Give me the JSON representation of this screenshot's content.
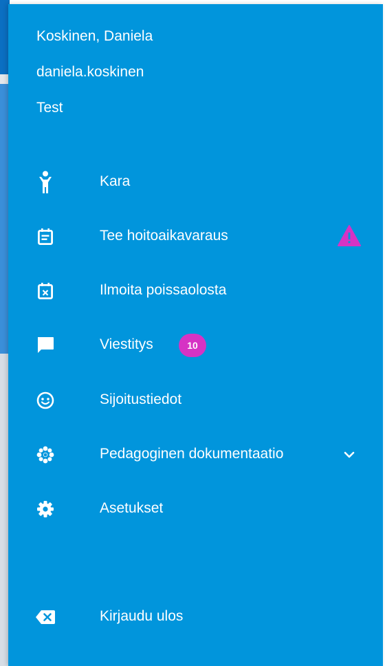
{
  "user": {
    "name": "Koskinen, Daniela",
    "username": "daniela.koskinen",
    "role": "Test"
  },
  "menu": {
    "items": [
      {
        "label": "Kara",
        "icon": "child-icon"
      },
      {
        "label": "Tee hoitoaikavaraus",
        "icon": "calendar-note-icon",
        "alert_icon": "warning-icon"
      },
      {
        "label": "Ilmoita poissaolosta",
        "icon": "calendar-x-icon"
      },
      {
        "label": "Viestitys",
        "icon": "chat-icon",
        "badge": "10"
      },
      {
        "label": "Sijoitustiedot",
        "icon": "smiley-icon"
      },
      {
        "label": "Pedagoginen dokumentaatio",
        "icon": "snowflake-icon",
        "expand_icon": "chevron-down-icon"
      },
      {
        "label": "Asetukset",
        "icon": "gear-icon"
      }
    ],
    "logout": {
      "label": "Kirjaudu ulos",
      "icon": "backspace-icon"
    }
  },
  "colors": {
    "drawer_background": "#0195dc",
    "text": "#ffffff",
    "badge": "#d633c4",
    "warning": "#d633c4"
  }
}
